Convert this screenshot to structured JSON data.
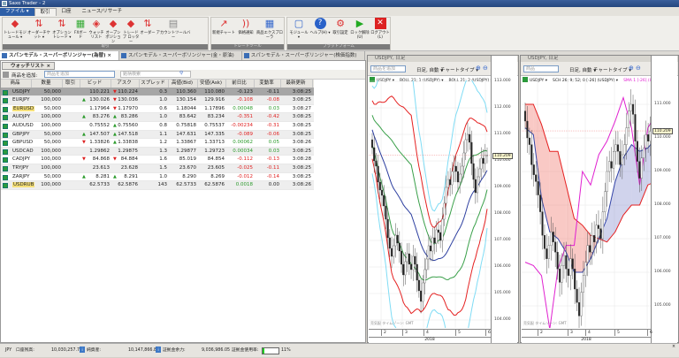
{
  "window": {
    "title": "Saxo Trader - 2"
  },
  "menu": {
    "tabs": [
      "ファイル ▾",
      "取引",
      "口座",
      "ニュース/リサーチ"
    ]
  },
  "ribbon": {
    "groups": [
      {
        "label": "取引"
      },
      {
        "label": "トレードツール"
      },
      {
        "label": "プラットフォーム"
      }
    ],
    "buttons": [
      {
        "label": "トレードモジュール ▾",
        "icon": "trade-module-icon",
        "glyph": "◆",
        "color": "#d33"
      },
      {
        "label": "オーダーチケット ▾",
        "icon": "order-ticket-icon",
        "glyph": "⇅",
        "color": "#d33"
      },
      {
        "label": "オプショントレード ▾",
        "icon": "option-trade-icon",
        "glyph": "⇅",
        "color": "#d33"
      },
      {
        "label": "FXボード",
        "icon": "fx-board-icon",
        "glyph": "▦",
        "color": "#3a3"
      },
      {
        "label": "ウォッチリスト",
        "icon": "watchlist-icon",
        "glyph": "◈",
        "color": "#d33"
      },
      {
        "label": "オープン ポジション",
        "icon": "open-position-icon",
        "glyph": "◆",
        "color": "#d33"
      },
      {
        "label": "トレードブ ロッター",
        "icon": "trade-blotter-icon",
        "glyph": "◆",
        "color": "#d33"
      },
      {
        "label": "オーダー",
        "icon": "order-icon",
        "glyph": "⇅",
        "color": "#d33"
      },
      {
        "label": "アカウントツールバー",
        "icon": "account-toolbar-icon",
        "glyph": "▤",
        "color": "#888"
      },
      {
        "label": "新規チャート",
        "icon": "chart-icon",
        "glyph": "↗",
        "color": "#d33"
      },
      {
        "label": "価格通知",
        "icon": "price-alert-icon",
        "glyph": "))",
        "color": "#d33"
      },
      {
        "label": "商品エクスプローラ",
        "icon": "instrument-explorer-icon",
        "glyph": "▦",
        "color": "#36c"
      },
      {
        "label": "モジュール ▾",
        "icon": "module-icon",
        "glyph": "▢",
        "color": "#36c"
      },
      {
        "label": "ヘルプ(H) ▾",
        "icon": "help-icon",
        "glyph": "?",
        "color": "#fff"
      },
      {
        "label": "取引設定",
        "icon": "trade-settings-icon",
        "glyph": "⚙",
        "color": "#d33"
      },
      {
        "label": "ロック解除(U)",
        "icon": "unlock-icon",
        "glyph": "▶",
        "color": "#2a2"
      },
      {
        "label": "ログアウト(L)",
        "icon": "logout-icon",
        "glyph": "✕",
        "color": "#fff"
      }
    ]
  },
  "doc_tabs": [
    "スパンモデル・スーパーボリンジャー(為替)",
    "スパンモデル・スーパーボリンジャー(金・原油)",
    "スパンモデル・スーパーボリンジャー(株価指数)"
  ],
  "doc_tab_close": "×",
  "watchlist": {
    "tab_label": "ウォッチリスト",
    "tab_close": "×",
    "add_label": "商品を追加:",
    "add_placeholder": "商品を追加",
    "search_placeholder": "銘柄検索",
    "columns": [
      "商品",
      "数量",
      "取引",
      "ビッド",
      "アスク",
      "スプレッド",
      "高値(Bid)",
      "安値(Ask)",
      "前日比",
      "変動率",
      "最新更新"
    ],
    "rows": [
      {
        "sym": "USDJPY",
        "qty": "50,000",
        "bid": "110.221",
        "ask": "110.224",
        "spread": "0.3",
        "high": "110.360",
        "low": "110.080",
        "chg": "-0.123",
        "pct": "-0.11",
        "time": "3:08:25",
        "bidArrow": "",
        "askArrow": "down"
      },
      {
        "sym": "EURJPY",
        "qty": "100,000",
        "bid": "130.026",
        "ask": "130.036",
        "spread": "1.0",
        "high": "130.154",
        "low": "129.916",
        "chg": "-0.108",
        "pct": "-0.08",
        "time": "3:08:25",
        "bidArrow": "up",
        "askArrow": "down"
      },
      {
        "sym": "EURUSD",
        "qty": "50,000",
        "bid": "1.17964",
        "ask": "1.17970",
        "spread": "0.6",
        "high": "1.18044",
        "low": "1.17896",
        "chg": "0.00048",
        "pct": "0.03",
        "time": "3:08:27",
        "bidArrow": "",
        "askArrow": "down",
        "highlight": true
      },
      {
        "sym": "AUDJPY",
        "qty": "100,000",
        "bid": "83.276",
        "ask": "83.286",
        "spread": "1.0",
        "high": "83.642",
        "low": "83.234",
        "chg": "-0.351",
        "pct": "-0.42",
        "time": "3:08:25",
        "bidArrow": "up",
        "askArrow": "up"
      },
      {
        "sym": "AUDUSD",
        "qty": "100,000",
        "bid": "0.75552",
        "ask": "0.75560",
        "spread": "0.8",
        "high": "0.75818",
        "low": "0.75537",
        "chg": "-0.00234",
        "pct": "-0.31",
        "time": "3:08:25",
        "bidArrow": "",
        "askArrow": "up"
      },
      {
        "sym": "GBPJPY",
        "qty": "50,000",
        "bid": "147.507",
        "ask": "147.518",
        "spread": "1.1",
        "high": "147.631",
        "low": "147.335",
        "chg": "-0.089",
        "pct": "-0.06",
        "time": "3:08:25",
        "bidArrow": "up",
        "askArrow": "up"
      },
      {
        "sym": "GBPUSD",
        "qty": "50,000",
        "bid": "1.33826",
        "ask": "1.33838",
        "spread": "1.2",
        "high": "1.33867",
        "low": "1.33713",
        "chg": "0.00062",
        "pct": "0.05",
        "time": "3:08:26",
        "bidArrow": "down",
        "askArrow": "up"
      },
      {
        "sym": "USDCAD",
        "qty": "100,000",
        "bid": "1.29862",
        "ask": "1.29875",
        "spread": "1.3",
        "high": "1.29877",
        "low": "1.29723",
        "chg": "0.00034",
        "pct": "0.03",
        "time": "3:08:25",
        "bidArrow": "",
        "askArrow": ""
      },
      {
        "sym": "CADJPY",
        "qty": "100,000",
        "bid": "84.868",
        "ask": "84.884",
        "spread": "1.6",
        "high": "85.019",
        "low": "84.854",
        "chg": "-0.112",
        "pct": "-0.13",
        "time": "3:08:28",
        "bidArrow": "down",
        "askArrow": "down"
      },
      {
        "sym": "TRYJPY",
        "qty": "100,000",
        "bid": "23.613",
        "ask": "23.628",
        "spread": "1.5",
        "high": "23.670",
        "low": "23.605",
        "chg": "-0.025",
        "pct": "-0.11",
        "time": "3:08:25",
        "bidArrow": "",
        "askArrow": ""
      },
      {
        "sym": "ZARJPY",
        "qty": "50,000",
        "bid": "8.281",
        "ask": "8.291",
        "spread": "1.0",
        "high": "8.290",
        "low": "8.269",
        "chg": "-0.012",
        "pct": "-0.14",
        "time": "3:08:25",
        "bidArrow": "up",
        "askArrow": "up"
      },
      {
        "sym": "USDRUB",
        "qty": "100,000",
        "bid": "62.5733",
        "ask": "62.5876",
        "spread": "143",
        "high": "62.5733",
        "low": "62.5876",
        "chg": "0.0018",
        "pct": "0.00",
        "time": "3:08:26",
        "bidArrow": "",
        "askArrow": "",
        "highlight": true
      }
    ]
  },
  "charts": [
    {
      "title": "USDJPY, 日足",
      "search_placeholder": "商品を追加",
      "period": "日足, 自動 ▾",
      "chart_type": "チャートタイプ ▾",
      "indicators": [
        "USDJPY ▾",
        "BOLL 21; 1 (USDJPY) ▾",
        "BOLL 21; 2 (USDJPY) ▾",
        "BOL"
      ],
      "y_ticks": [
        "113.000",
        "112.000",
        "111.000",
        "110.000",
        "109.000",
        "108.000",
        "107.000",
        "106.000",
        "105.000",
        "104.000"
      ],
      "current_price": "110.209",
      "x_ticks": [
        "2",
        "3",
        "4",
        "5",
        "6"
      ],
      "year": "2018",
      "footer": "売気配 タイムゾーン: GMT"
    },
    {
      "title": "USDJPY, 日足",
      "search_placeholder": "商品",
      "period": "日足, 自動 ▾",
      "chart_type": "チャートタイプ ▾",
      "indicators": [
        "USDJPY ▾",
        "SCH 26; 9; 52; 0 [-26] (USDJPY) ▾",
        "SMA 1 [-26] (USDJPY) ▾"
      ],
      "y_ticks": [
        "111.000",
        "110.000",
        "109.000",
        "108.000",
        "107.000",
        "106.000",
        "105.000"
      ],
      "current_price": "110.209",
      "x_ticks": [
        "2",
        "3",
        "4",
        "5",
        "6"
      ],
      "year": "2018",
      "footer": "売気配 タイムゾーン: GMT"
    }
  ],
  "chart_data": {
    "type": "line",
    "closes": [
      110.5,
      110.0,
      109.8,
      109.2,
      108.9,
      108.7,
      108.3,
      107.8,
      107.1,
      106.7,
      106.4,
      106.8,
      107.2,
      106.9,
      106.6,
      106.1,
      105.7,
      106.2,
      106.5,
      106.1,
      105.9,
      106.4,
      106.1,
      105.5,
      105.1,
      104.7,
      105.4,
      105.9,
      106.3,
      106.8,
      106.6,
      107.1,
      106.9,
      107.4,
      107.3,
      107.0,
      107.8,
      108.4,
      109.0,
      109.3,
      109.1,
      109.6,
      109.8,
      109.6,
      109.2,
      109.5,
      109.8,
      110.3,
      110.8,
      111.0,
      110.7,
      109.9,
      109.3,
      108.8,
      109.4,
      109.7,
      110.1,
      109.9,
      110.2,
      110.209
    ],
    "span_upper": [
      111.0,
      111.0,
      110.4,
      109.6,
      109.6,
      108.6,
      107.6,
      107.4,
      107.1,
      107.0,
      106.9,
      107.2,
      107.7,
      108.0,
      108.0,
      108.6,
      108.7
    ],
    "span_lower": [
      110.3,
      110.1,
      108.2,
      107.2,
      107.0,
      106.6,
      106.0,
      106.0,
      106.4,
      107.0,
      107.6,
      108.7,
      109.4,
      109.8,
      109.6,
      109.7,
      110.0
    ],
    "sma_lagging": [
      106.3,
      106.2,
      105.9,
      104.3,
      106.1,
      106.8,
      106.8,
      109.0,
      108.6,
      109.5,
      109.9,
      110.5,
      111.2,
      110.3,
      108.6,
      110.3,
      110.7
    ],
    "colors": {
      "bb_mid": "#2d3fa0",
      "bb_1": "#3aa04a",
      "bb_2": "#e52020",
      "bb_3": "#7fdcf5",
      "span_upper": "#e52020",
      "span_lower": "#3344a8",
      "sma": "#e020d0"
    }
  },
  "status": {
    "currency": "JPY",
    "balance_label": "口座残高:",
    "balance": "10,030,257.79",
    "equity_label": "純資産:",
    "equity": "10,147,866.82",
    "margin_label": "証拠金余力:",
    "margin": "9,036,986.05",
    "usage_label": "証拠金使用率:",
    "usage_pct": 11,
    "usage_text": "11%",
    "close": "×"
  }
}
